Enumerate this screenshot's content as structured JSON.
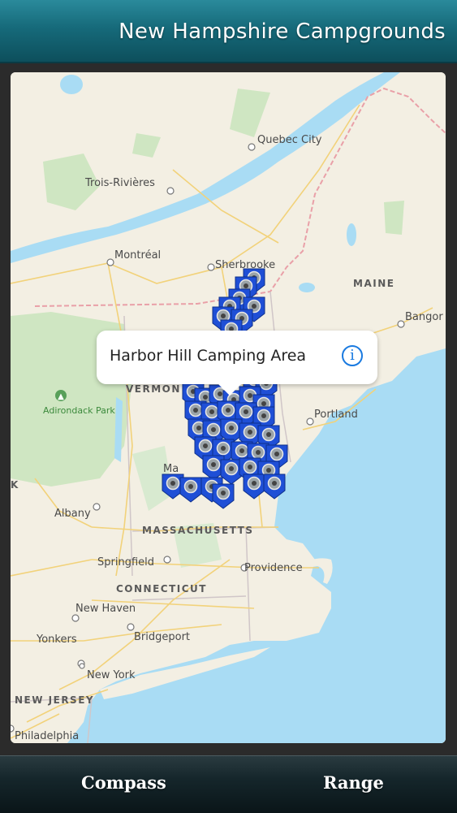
{
  "header": {
    "title": "New Hampshire Campgrounds"
  },
  "map": {
    "cities": {
      "quebec_city": "Quebec City",
      "trois_rivieres": "Trois-Rivières",
      "montreal": "Montréal",
      "sherbrooke": "Sherbrooke",
      "bangor": "Bangor",
      "portland": "Portland",
      "albany": "Albany",
      "springfield": "Springfield",
      "providence": "Providence",
      "new_haven": "New Haven",
      "bridgeport": "Bridgeport",
      "yonkers": "Yonkers",
      "new_york": "New York",
      "philadelphia": "Philadelphia",
      "adirondack_park": "Adirondack Park",
      "vermont_partial": "VERMON",
      "ma_partial": "Ma",
      "k_partial": "K"
    },
    "states": {
      "maine": "MAINE",
      "massachusetts": "MASSACHUSETTS",
      "connecticut": "CONNECTICUT",
      "new_jersey": "NEW JERSEY"
    },
    "water_color": "#a9dcf4",
    "land_color": "#f3efe3",
    "pin_color": "#1f4fd6"
  },
  "callout": {
    "name": "Harbor Hill Camping Area",
    "info_glyph": "i"
  },
  "footer": {
    "compass_label": "Compass",
    "range_label": "Range"
  }
}
